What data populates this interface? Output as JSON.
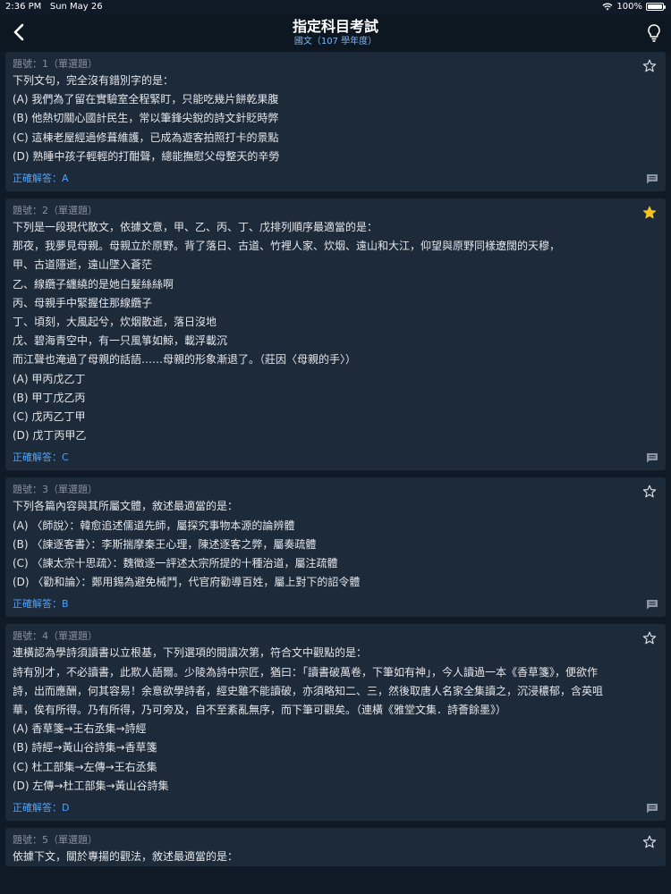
{
  "status": {
    "time": "2:36 PM",
    "date": "Sun May 26",
    "battery": "100%"
  },
  "nav": {
    "title": "指定科目考試",
    "subtitle": "國文（107 學年度）"
  },
  "questions": [
    {
      "header": "題號：1（單選題）",
      "starred": false,
      "lines": [
        "下列文句，完全沒有錯別字的是：",
        "(A) 我們為了留在實驗室全程緊盯，只能吃幾片餅乾果腹",
        "(B) 他熱切關心國計民生，常以筆鋒尖銳的詩文針貶時弊",
        "(C) 這棟老屋經過修葺維護，已成為遊客拍照打卡的景點",
        "(D) 熟睡中孩子輕輕的打酣聲，總能撫慰父母整天的辛勞"
      ],
      "answer": "正確解答：A"
    },
    {
      "header": "題號：2（單選題）",
      "starred": true,
      "lines": [
        "下列是一段現代散文，依據文意，甲、乙、丙、丁、戊排列順序最適當的是：",
        "那夜，我夢見母親。母親立於原野。背了落日、古道、竹裡人家、炊烟、遠山和大江，仰望與原野同樣遼闊的天穆，",
        "甲、古道隱逝，遠山墜入蒼茫",
        "乙、線纜子纏繞的是她白髮絲絲啊",
        "丙、母親手中緊握住那線纜子",
        "丁、頃刻，大風起兮，炊烟散逝，落日沒地",
        "戊、碧海青空中，有一只風箏如鯨，載浮載沉",
        "而江聲也淹過了母親的話語……母親的形象漸退了。（莊因〈母親的手〉）",
        "(A) 甲丙戊乙丁",
        "(B) 甲丁戊乙丙",
        "(C) 戊丙乙丁甲",
        "(D) 戊丁丙甲乙"
      ],
      "answer": "正確解答：C"
    },
    {
      "header": "題號：3（單選題）",
      "starred": false,
      "lines": [
        "下列各篇內容與其所屬文體，敘述最適當的是：",
        "(A) 〈師說〉：韓愈追述儒道先師，屬探究事物本源的論辨體",
        "(B) 〈諫逐客書〉：李斯揣摩秦王心理，陳述逐客之弊，屬奏疏體",
        "(C) 〈諫太宗十思疏〉：魏徵逐一評述太宗所提的十種治道，屬注疏體",
        "(D) 〈勸和論〉：鄭用錫為避免械鬥，代官府勸導百姓，屬上對下的詔令體"
      ],
      "answer": "正確解答：B"
    },
    {
      "header": "題號：4（單選題）",
      "starred": false,
      "lines": [
        "連橫認為學詩須讀書以立根基，下列選項的閱讀次第，符合文中觀點的是：",
        "詩有別才，不必讀書，此欺人語爾。少陵為詩中宗匠，猶曰：「讀書破萬卷，下筆如有神」，今人讀過一本《香草箋》，便欲作",
        "詩，出而應酬，何其容易！余意欲學詩者，經史雖不能讀破，亦須略知二、三，然後取唐人名家全集讀之，沉浸穠郁，含英咀",
        "華，俟有所得。乃有所得，乃可旁及，自不至紊亂無序，而下筆可觀矣。（連橫《雅堂文集．詩薈餘墨》）",
        "(A) 香草箋→王右丞集→詩經",
        "(B) 詩經→黃山谷詩集→香草箋",
        "(C) 杜工部集→左傳→王右丞集",
        "(D) 左傳→杜工部集→黃山谷詩集"
      ],
      "answer": "正確解答：D"
    },
    {
      "header": "題號：5（單選題）",
      "starred": false,
      "lines": [
        "依據下文，關於專揚的觀法，敘述最適當的是："
      ],
      "answer": ""
    }
  ],
  "colors": {
    "background": "#0f1a26",
    "card": "#1d2a3a",
    "accent": "#4da3ff",
    "star": "#f5c518"
  }
}
